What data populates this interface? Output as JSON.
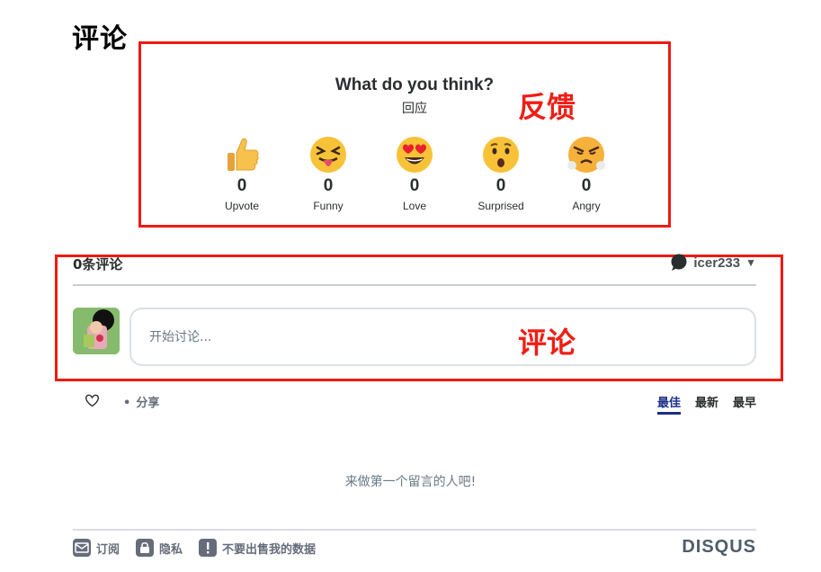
{
  "page": {
    "title": "评论"
  },
  "annotations": {
    "feedback_label": "反馈",
    "comment_label": "评论",
    "box_color": "#ee1a12"
  },
  "reactions": {
    "title": "What do you think?",
    "subtitle": "回应",
    "items": [
      {
        "label": "Upvote",
        "count": "0",
        "icon": "thumbs-up-icon"
      },
      {
        "label": "Funny",
        "count": "0",
        "icon": "tongue-out-emoji-icon"
      },
      {
        "label": "Love",
        "count": "0",
        "icon": "heart-eyes-emoji-icon"
      },
      {
        "label": "Surprised",
        "count": "0",
        "icon": "surprised-emoji-icon"
      },
      {
        "label": "Angry",
        "count": "0",
        "icon": "angry-emoji-icon"
      }
    ]
  },
  "comments": {
    "count_label": "0条评论",
    "username": "icer233",
    "input_placeholder": "开始讨论...",
    "share_label": "分享",
    "sort_tabs": [
      {
        "label": "最佳",
        "active": true
      },
      {
        "label": "最新",
        "active": false
      },
      {
        "label": "最早",
        "active": false
      }
    ],
    "empty_message": "来做第一个留言的人吧!"
  },
  "footer": {
    "subscribe_label": "订阅",
    "privacy_label": "隐私",
    "do_not_sell_label": "不要出售我的数据",
    "brand": "DISQUS"
  },
  "colors": {
    "accent": "#1d2f88",
    "annotation_red": "#ee1a12",
    "text": "#2a2e2e",
    "muted": "#656c7a"
  }
}
